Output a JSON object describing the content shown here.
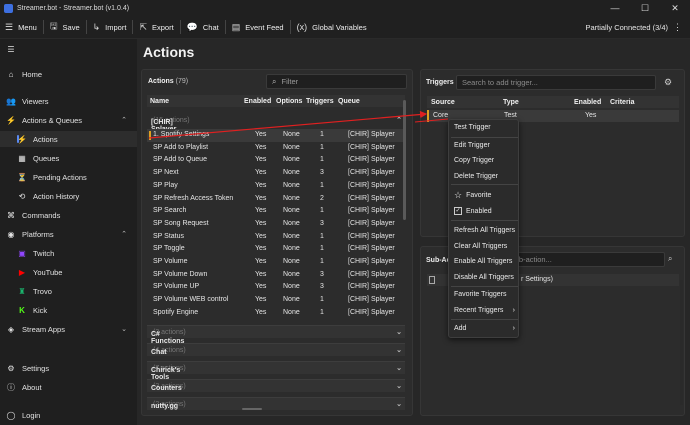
{
  "window": {
    "title": "Streamer.bot - Streamer.bot (v1.0.4)",
    "controls": [
      "—",
      "☐",
      "✕"
    ]
  },
  "toolbar": {
    "items": [
      {
        "label": "Menu",
        "icon": "menu-icon"
      },
      {
        "label": "Save",
        "icon": "save-icon"
      },
      {
        "label": "Import",
        "icon": "import-icon"
      },
      {
        "label": "Export",
        "icon": "export-icon"
      },
      {
        "label": "Chat",
        "icon": "chat-icon"
      },
      {
        "label": "Event Feed",
        "icon": "event-feed-icon"
      },
      {
        "label": "Global Variables",
        "icon": "variables-icon"
      }
    ],
    "status": "Partially Connected (3/4)"
  },
  "sidebar": {
    "items": [
      {
        "label": "Home",
        "icon": "home-icon"
      },
      {
        "label": "Viewers",
        "icon": "viewers-icon"
      },
      {
        "label": "Actions & Queues",
        "icon": "actions-queues-icon"
      },
      {
        "label": "Actions",
        "icon": "actions-icon"
      },
      {
        "label": "Queues",
        "icon": "queues-icon"
      },
      {
        "label": "Pending Actions",
        "icon": "pending-actions-icon"
      },
      {
        "label": "Action History",
        "icon": "history-icon"
      },
      {
        "label": "Commands",
        "icon": "commands-icon"
      },
      {
        "label": "Platforms",
        "icon": "platforms-icon"
      },
      {
        "label": "Twitch",
        "icon": "twitch-icon"
      },
      {
        "label": "YouTube",
        "icon": "youtube-icon"
      },
      {
        "label": "Trovo",
        "icon": "trovo-icon"
      },
      {
        "label": "Kick",
        "icon": "kick-icon"
      },
      {
        "label": "Stream Apps",
        "icon": "stream-apps-icon"
      },
      {
        "label": "Settings",
        "icon": "settings-icon"
      },
      {
        "label": "About",
        "icon": "about-icon"
      },
      {
        "label": "Login",
        "icon": "login-icon"
      }
    ]
  },
  "page": {
    "title": "Actions"
  },
  "actions": {
    "label": "Actions",
    "count": "(79)",
    "filter_placeholder": "Filter",
    "columns": [
      "Name",
      "Enabled",
      "Options",
      "Triggers",
      "Queue"
    ],
    "group": {
      "name": "[CHIR] Splayer",
      "count": "(15 actions)"
    },
    "rows": [
      [
        "1. Spotify Settings",
        "Yes",
        "None",
        "1",
        "[CHIR] Splayer"
      ],
      [
        "SP Add to Playlist",
        "Yes",
        "None",
        "1",
        "[CHIR] Splayer"
      ],
      [
        "SP Add to Queue",
        "Yes",
        "None",
        "1",
        "[CHIR] Splayer"
      ],
      [
        "SP Next",
        "Yes",
        "None",
        "3",
        "[CHIR] Splayer"
      ],
      [
        "SP Play",
        "Yes",
        "None",
        "1",
        "[CHIR] Splayer"
      ],
      [
        "SP Refresh Access Token",
        "Yes",
        "None",
        "2",
        "[CHIR] Splayer"
      ],
      [
        "SP Search",
        "Yes",
        "None",
        "1",
        "[CHIR] Splayer"
      ],
      [
        "SP Song Request",
        "Yes",
        "None",
        "3",
        "[CHIR] Splayer"
      ],
      [
        "SP Status",
        "Yes",
        "None",
        "1",
        "[CHIR] Splayer"
      ],
      [
        "SP Toggle",
        "Yes",
        "None",
        "1",
        "[CHIR] Splayer"
      ],
      [
        "SP Volume",
        "Yes",
        "None",
        "1",
        "[CHIR] Splayer"
      ],
      [
        "SP Volume Down",
        "Yes",
        "None",
        "3",
        "[CHIR] Splayer"
      ],
      [
        "SP Volume UP",
        "Yes",
        "None",
        "3",
        "[CHIR] Splayer"
      ],
      [
        "SP Volume WEB control",
        "Yes",
        "None",
        "1",
        "[CHIR] Splayer"
      ],
      [
        "Spotify Engine",
        "Yes",
        "None",
        "1",
        "[CHIR] Splayer"
      ]
    ],
    "collapsed_groups": [
      {
        "name": "C# Functions",
        "count": "(3 actions)"
      },
      {
        "name": "Chat",
        "count": "(4 actions)"
      },
      {
        "name": "Chirick's Tools",
        "count": "(7 actions)"
      },
      {
        "name": "Counters",
        "count": "(3 actions)"
      },
      {
        "name": "nutty.gg",
        "count": "(2 actions)"
      }
    ]
  },
  "triggers": {
    "label": "Triggers",
    "search_placeholder": "Search to add trigger...",
    "columns": [
      "Source",
      "Type",
      "Enabled",
      "Criteria"
    ],
    "row": [
      "Core",
      "Test",
      "Yes",
      ""
    ]
  },
  "subactions": {
    "label": "Sub-Ac",
    "search_placeholder": "sub-action...",
    "row_text": "r Settings)"
  },
  "context_menu": {
    "items": [
      "Test Trigger",
      "Edit Trigger",
      "Copy Trigger",
      "Delete Trigger",
      "Favorite",
      "Enabled",
      "Refresh All Triggers",
      "Clear All Triggers",
      "Enable All Triggers",
      "Disable All Triggers",
      "Favorite Triggers",
      "Recent Triggers",
      "Add"
    ],
    "submenu_arrow": "›"
  },
  "colors": {
    "annotation_red": "#e02020",
    "accent": "#5b8af0"
  }
}
